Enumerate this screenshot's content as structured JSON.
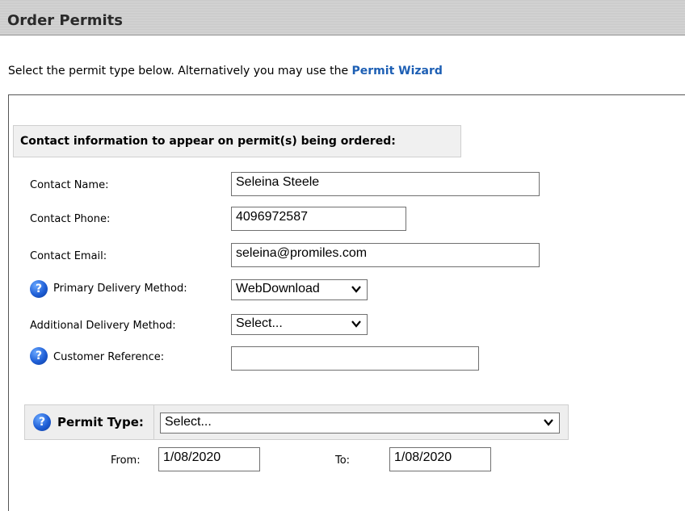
{
  "header": {
    "title": "Order Permits"
  },
  "intro": {
    "text": "Select the permit type below. Alternatively you may use the ",
    "link": "Permit Wizard"
  },
  "contact": {
    "section_title": "Contact information to appear on permit(s) being ordered:",
    "name_label": "Contact Name:",
    "name_value": "Seleina Steele",
    "phone_label": "Contact Phone:",
    "phone_value": "4096972587",
    "email_label": "Contact Email:",
    "email_value": "seleina@promiles.com",
    "primary_label": "Primary Delivery Method:",
    "primary_value": "WebDownload",
    "additional_label": "Additional Delivery Method:",
    "additional_value": "Select...",
    "reference_label": "Customer Reference:",
    "reference_value": ""
  },
  "permit": {
    "type_label": "Permit Type:",
    "type_value": "Select...",
    "from_label": "From:",
    "from_value": "1/08/2020",
    "to_label": "To:",
    "to_value": "1/08/2020"
  },
  "icons": {
    "help": "help-icon",
    "dropdown": "chevron-down-icon"
  },
  "colors": {
    "link": "#1d5fb4",
    "help_icon": "#1f5fd6"
  }
}
